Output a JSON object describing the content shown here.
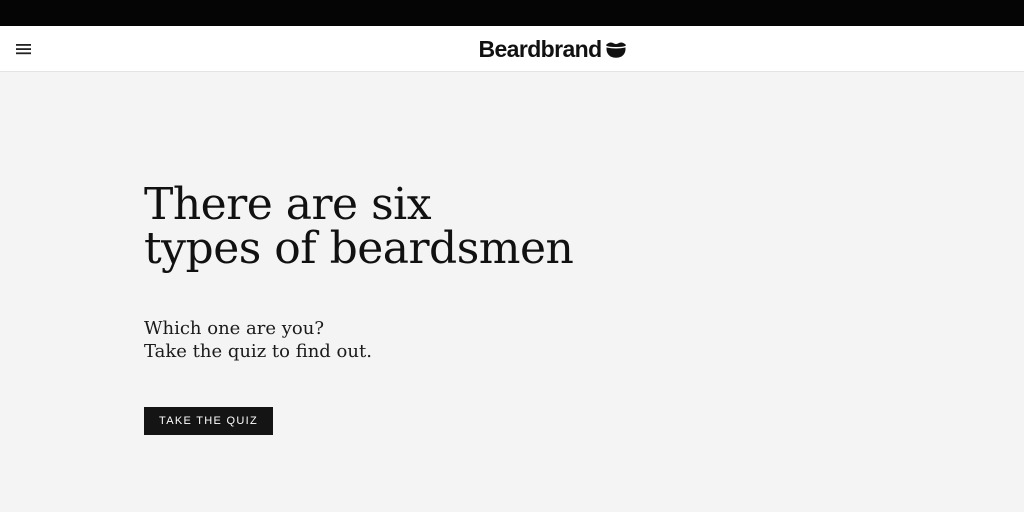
{
  "header": {
    "brand_name": "Beardbrand",
    "menu_icon": "hamburger-menu-icon",
    "logo_icon": "beard-mustache-icon"
  },
  "hero": {
    "headline_line1": "There are six",
    "headline_line2": "types of beardsmen",
    "subtext_line1": "Which one are you?",
    "subtext_line2": "Take the quiz to find out.",
    "cta_label": "TAKE THE QUIZ"
  },
  "colors": {
    "top_bar": "#050505",
    "header_bg": "#ffffff",
    "page_bg": "#f4f4f4",
    "text": "#111111",
    "button_bg": "#141414",
    "button_text": "#ffffff"
  }
}
